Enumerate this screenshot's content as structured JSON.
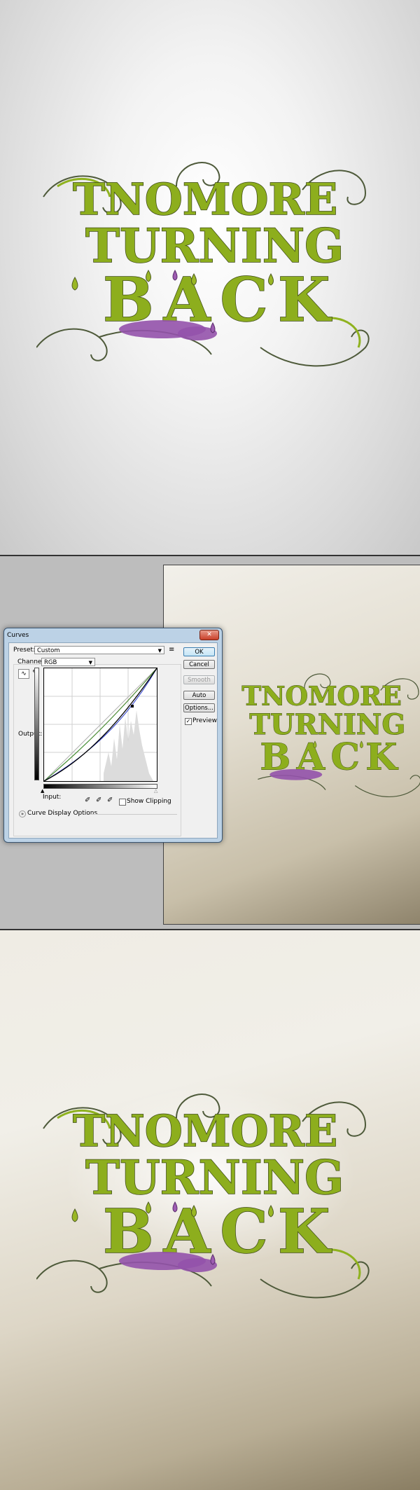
{
  "artwork": {
    "line1": "TNOMORE",
    "line2": "TURNING",
    "line3": "BACK",
    "colors": {
      "green": "#8dae1d",
      "purple": "#9452ab",
      "outline": "#3e4a1a"
    }
  },
  "curves_dialog": {
    "title": "Curves",
    "close_glyph": "✕",
    "preset_label": "Preset:",
    "preset_value": "Custom",
    "preset_menu_glyph": "≡",
    "channel_label": "Channel:",
    "channel_value": "RGB",
    "output_label": "Output:",
    "input_label": "Input:",
    "show_clipping_label": "Show Clipping",
    "curve_display_options_label": "Curve Display Options",
    "buttons": {
      "ok": "OK",
      "cancel": "Cancel",
      "smooth": "Smooth",
      "auto": "Auto",
      "options": "Options..."
    },
    "preview_label": "Preview",
    "preview_checked": true,
    "curve_colors": {
      "rgb": "#000000",
      "red": "#cc3a2a",
      "green": "#3a9a3a",
      "blue": "#2a3acc"
    }
  }
}
